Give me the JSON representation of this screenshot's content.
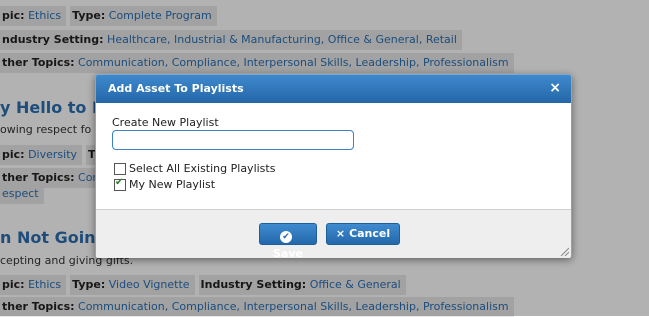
{
  "background": {
    "row1": {
      "topic_label": "pic:",
      "topic": "Ethics",
      "type_label": "Type:",
      "type": "Complete Program"
    },
    "row2": {
      "industry_label": "ndustry Setting:",
      "industry": "Healthcare, Industrial & Manufacturing, Office & General, Retail"
    },
    "row3": {
      "other_label": "ther Topics:",
      "other": "Communication, Compliance, Interpersonal Skills, Leadership, Professionalism"
    },
    "item2_title": "y Hello to Ke",
    "item2_desc": "owing respect fo",
    "row4": {
      "topic_label": "pic:",
      "topic": "Diversity",
      "type_label": "T"
    },
    "row5": {
      "other_label": "ther Topics:",
      "other": "Com"
    },
    "row5b": "espect",
    "item3_title": "n Not Going t",
    "item3_desc": "cepting and giving gifts.",
    "row6": {
      "topic_label": "pic:",
      "topic": "Ethics",
      "type_label": "Type:",
      "type": "Video Vignette",
      "industry_label": "Industry Setting:",
      "industry": "Office & General"
    },
    "row7": {
      "other_label": "ther Topics:",
      "other": "Communication, Compliance, Interpersonal Skills, Leadership, Professionalism"
    }
  },
  "modal": {
    "title": "Add Asset To Playlists",
    "close": "×",
    "create_label": "Create New Playlist",
    "input_value": "",
    "input_placeholder": "",
    "select_all_label": "Select All Existing Playlists",
    "select_all_checked": false,
    "playlists": [
      {
        "label": "My New Playlist",
        "checked": true
      }
    ],
    "save_label": "Save",
    "cancel_label": "Cancel"
  }
}
